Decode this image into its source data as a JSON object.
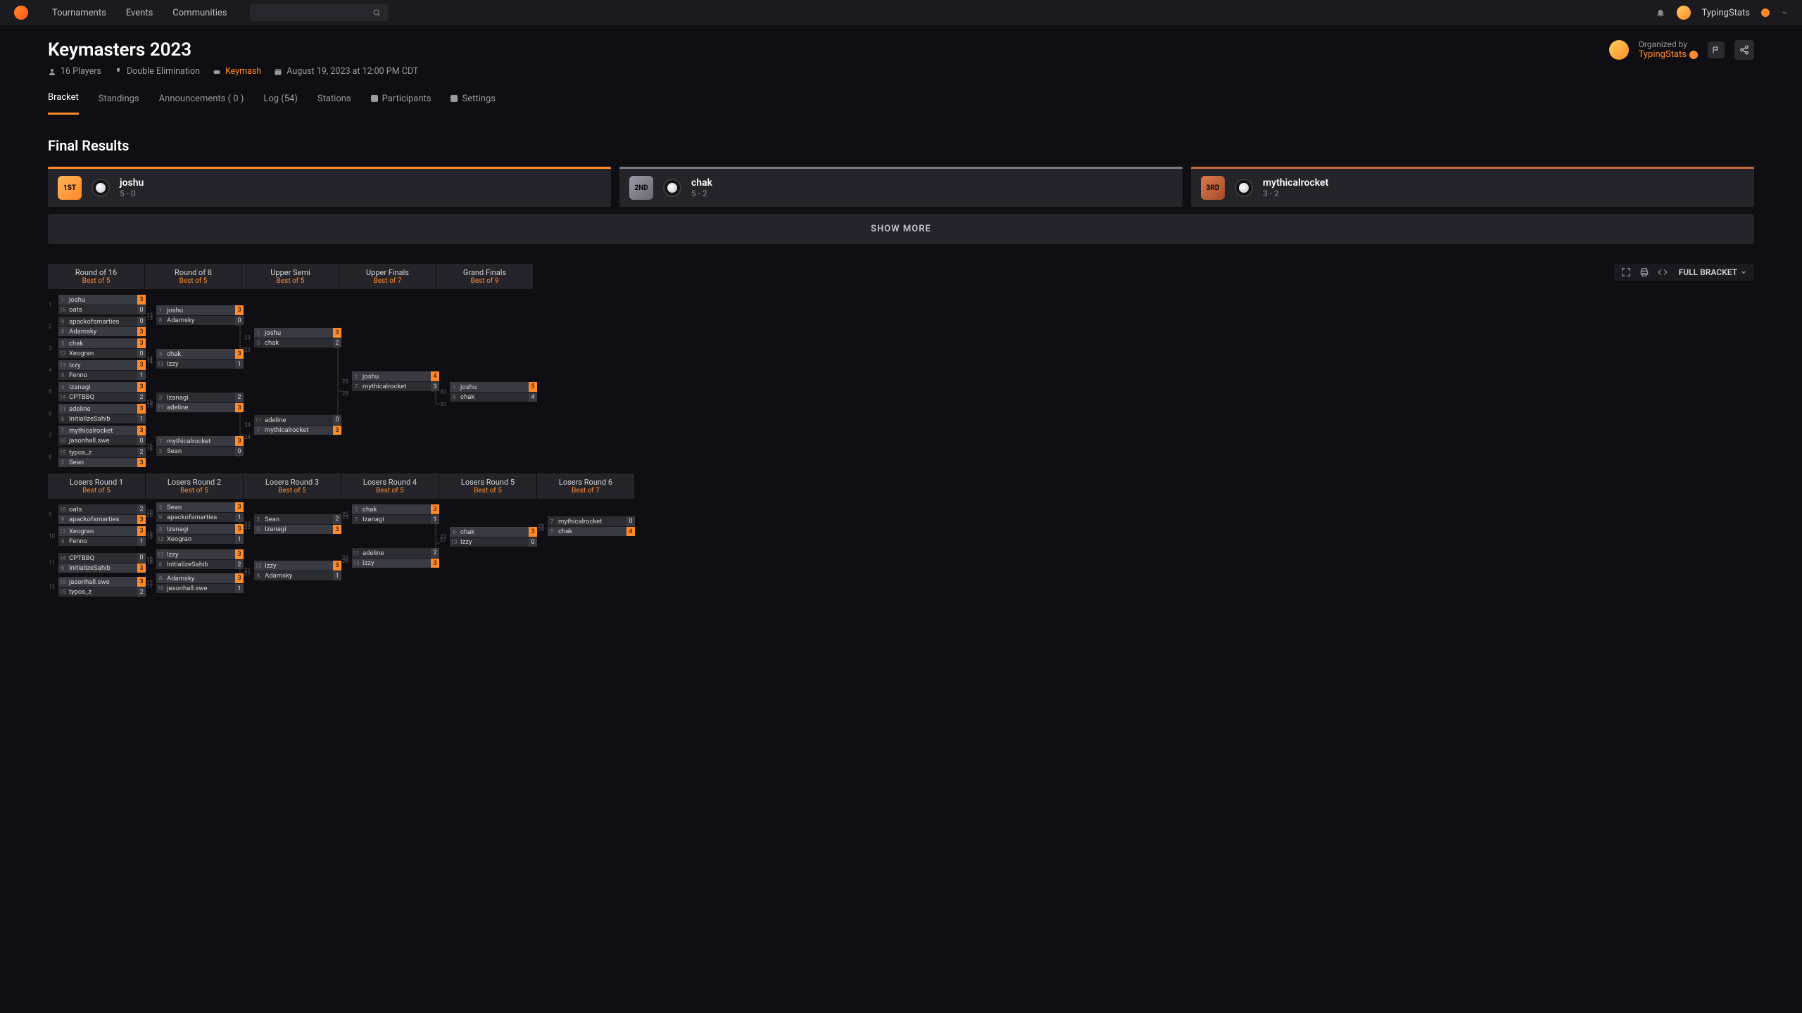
{
  "nav": {
    "links": [
      "Tournaments",
      "Events",
      "Communities"
    ],
    "user_name": "TypingStats"
  },
  "header": {
    "title": "Keymasters 2023",
    "players": "16 Players",
    "format": "Double Elimination",
    "game": "Keymash",
    "datetime": "August 19, 2023 at 12:00 PM CDT",
    "organized_label": "Organized by",
    "organizer": "TypingStats"
  },
  "tabs": {
    "bracket": "Bracket",
    "standings": "Standings",
    "announcements": "Announcements ( 0 )",
    "log": "Log (54)",
    "stations": "Stations",
    "participants": "Participants",
    "settings": "Settings"
  },
  "final_results": {
    "title": "Final Results",
    "first": {
      "name": "joshu",
      "score": "5 - 0",
      "medal": "1ST"
    },
    "second": {
      "name": "chak",
      "score": "5 - 2",
      "medal": "2ND"
    },
    "third": {
      "name": "mythicalrocket",
      "score": "3 - 2",
      "medal": "3RD"
    },
    "show_more": "SHOW MORE"
  },
  "bracket_tools": {
    "full_bracket": "FULL BRACKET"
  },
  "winners_rounds": [
    {
      "name": "Round of 16",
      "best": "Best of 5"
    },
    {
      "name": "Round of 8",
      "best": "Best of 5"
    },
    {
      "name": "Upper Semi",
      "best": "Best of 5"
    },
    {
      "name": "Upper Finals",
      "best": "Best of 7"
    },
    {
      "name": "Grand Finals",
      "best": "Best of 9"
    }
  ],
  "losers_rounds": [
    {
      "name": "Losers Round 1",
      "best": "Best of 5"
    },
    {
      "name": "Losers Round 2",
      "best": "Best of 5"
    },
    {
      "name": "Losers Round 3",
      "best": "Best of 5"
    },
    {
      "name": "Losers Round 4",
      "best": "Best of 5"
    },
    {
      "name": "Losers Round 5",
      "best": "Best of 5"
    },
    {
      "name": "Losers Round 6",
      "best": "Best of 7"
    }
  ],
  "wm": {
    "m1": {
      "a": {
        "s": "1",
        "n": "joshu",
        "v": "3",
        "w": true
      },
      "b": {
        "s": "16",
        "n": "oats",
        "v": "0"
      }
    },
    "m2": {
      "a": {
        "s": "9",
        "n": "apackofsmarties",
        "v": "0"
      },
      "b": {
        "s": "8",
        "n": "Adamsky",
        "v": "3",
        "w": true
      }
    },
    "m3": {
      "a": {
        "s": "5",
        "n": "chak",
        "v": "3",
        "w": true
      },
      "b": {
        "s": "12",
        "n": "Xeogran",
        "v": "0"
      }
    },
    "m4": {
      "a": {
        "s": "13",
        "n": "Izzy",
        "v": "3",
        "w": true
      },
      "b": {
        "s": "4",
        "n": "Fenno",
        "v": "1"
      }
    },
    "m5": {
      "a": {
        "s": "3",
        "n": "Izanagi",
        "v": "3",
        "w": true
      },
      "b": {
        "s": "14",
        "n": "CPTBBQ",
        "v": "2"
      }
    },
    "m6": {
      "a": {
        "s": "11",
        "n": "adeline",
        "v": "3",
        "w": true
      },
      "b": {
        "s": "6",
        "n": "InitializeSahib",
        "v": "1"
      }
    },
    "m7": {
      "a": {
        "s": "7",
        "n": "mythicalrocket",
        "v": "3",
        "w": true
      },
      "b": {
        "s": "10",
        "n": "jasonhall.swe",
        "v": "0"
      }
    },
    "m8": {
      "a": {
        "s": "15",
        "n": "typos_z",
        "v": "2"
      },
      "b": {
        "s": "2",
        "n": "Sean",
        "v": "3",
        "w": true
      }
    },
    "m13": {
      "a": {
        "s": "1",
        "n": "joshu",
        "v": "3",
        "w": true
      },
      "b": {
        "s": "8",
        "n": "Adamsky",
        "v": "0"
      }
    },
    "m14": {
      "a": {
        "s": "5",
        "n": "chak",
        "v": "3",
        "w": true
      },
      "b": {
        "s": "13",
        "n": "Izzy",
        "v": "1"
      }
    },
    "m15": {
      "a": {
        "s": "3",
        "n": "Izanagi",
        "v": "2"
      },
      "b": {
        "s": "11",
        "n": "adeline",
        "v": "3",
        "w": true
      }
    },
    "m16": {
      "a": {
        "s": "7",
        "n": "mythicalrocket",
        "v": "3",
        "w": true
      },
      "b": {
        "s": "2",
        "n": "Sean",
        "v": "0"
      }
    },
    "m23": {
      "a": {
        "s": "1",
        "n": "joshu",
        "v": "3",
        "w": true
      },
      "b": {
        "s": "5",
        "n": "chak",
        "v": "2"
      }
    },
    "m24": {
      "a": {
        "s": "11",
        "n": "adeline",
        "v": "0"
      },
      "b": {
        "s": "7",
        "n": "mythicalrocket",
        "v": "3",
        "w": true
      }
    },
    "m28": {
      "a": {
        "s": "1",
        "n": "joshu",
        "v": "4",
        "w": true
      },
      "b": {
        "s": "7",
        "n": "mythicalrocket",
        "v": "3"
      }
    },
    "m30": {
      "a": {
        "s": "1",
        "n": "joshu",
        "v": "5",
        "w": true
      },
      "b": {
        "s": "5",
        "n": "chak",
        "v": "4"
      }
    }
  },
  "lm": {
    "m9": {
      "a": {
        "s": "16",
        "n": "oats",
        "v": "2"
      },
      "b": {
        "s": "9",
        "n": "apackofsmarties",
        "v": "3",
        "w": true
      }
    },
    "m10": {
      "a": {
        "s": "12",
        "n": "Xeogran",
        "v": "3",
        "w": true
      },
      "b": {
        "s": "4",
        "n": "Fenno",
        "v": "1"
      }
    },
    "m11": {
      "a": {
        "s": "14",
        "n": "CPTBBQ",
        "v": "0"
      },
      "b": {
        "s": "6",
        "n": "InitializeSahib",
        "v": "3",
        "w": true
      }
    },
    "m12": {
      "a": {
        "s": "10",
        "n": "jasonhall.swe",
        "v": "3",
        "w": true
      },
      "b": {
        "s": "15",
        "n": "typos_z",
        "v": "2"
      }
    },
    "m20": {
      "a": {
        "s": "2",
        "n": "Sean",
        "v": "3",
        "w": true
      },
      "b": {
        "s": "9",
        "n": "apackofsmarties",
        "v": "1"
      }
    },
    "m19": {
      "a": {
        "s": "3",
        "n": "Izanagi",
        "v": "3",
        "w": true
      },
      "b": {
        "s": "12",
        "n": "Xeogran",
        "v": "1"
      }
    },
    "m18": {
      "a": {
        "s": "13",
        "n": "Izzy",
        "v": "3",
        "w": true
      },
      "b": {
        "s": "6",
        "n": "InitializeSahib",
        "v": "2"
      }
    },
    "m17": {
      "a": {
        "s": "8",
        "n": "Adamsky",
        "v": "3",
        "w": true
      },
      "b": {
        "s": "10",
        "n": "jasonhall.swe",
        "v": "1"
      }
    },
    "m22": {
      "a": {
        "s": "2",
        "n": "Sean",
        "v": "2"
      },
      "b": {
        "s": "3",
        "n": "Izanagi",
        "v": "3",
        "w": true
      }
    },
    "m21": {
      "a": {
        "s": "13",
        "n": "Izzy",
        "v": "3",
        "w": true
      },
      "b": {
        "s": "8",
        "n": "Adamsky",
        "v": "1"
      }
    },
    "m25": {
      "a": {
        "s": "5",
        "n": "chak",
        "v": "3",
        "w": true
      },
      "b": {
        "s": "3",
        "n": "Izanagi",
        "v": "1"
      }
    },
    "m26": {
      "a": {
        "s": "11",
        "n": "adeline",
        "v": "2"
      },
      "b": {
        "s": "13",
        "n": "Izzy",
        "v": "3",
        "w": true
      }
    },
    "m27": {
      "a": {
        "s": "5",
        "n": "chak",
        "v": "3",
        "w": true
      },
      "b": {
        "s": "13",
        "n": "Izzy",
        "v": "0"
      }
    },
    "m29": {
      "a": {
        "s": "7",
        "n": "mythicalrocket",
        "v": "0"
      },
      "b": {
        "s": "5",
        "n": "chak",
        "v": "4",
        "w": true
      }
    }
  }
}
